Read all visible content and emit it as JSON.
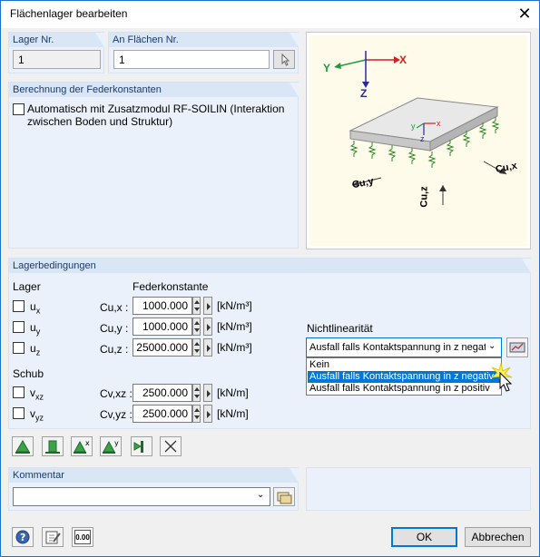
{
  "window": {
    "title": "Flächenlager bearbeiten"
  },
  "lager_nr": {
    "label": "Lager Nr.",
    "value": "1"
  },
  "an_flaechen": {
    "label": "An Flächen Nr.",
    "value": "1"
  },
  "federkonstanten": {
    "label": "Berechnung der Federkonstanten",
    "checkbox_label_line1": "Automatisch mit Zusatzmodul RF-SOILIN (Interaktion",
    "checkbox_label_line2": "zwischen Boden und Struktur)"
  },
  "diagram": {
    "axis_y": "Y",
    "axis_x": "X",
    "axis_z": "Z",
    "small_y": "y",
    "small_x": "x",
    "small_z": "z",
    "cuy": "Cu,y",
    "cux": "Cu,x",
    "cuz": "Cu,z",
    "colors": {
      "y_axis": "#1e9a3b",
      "x_axis": "#d42020",
      "z_axis": "#2a2a9a"
    }
  },
  "lagerbedingungen": {
    "label": "Lagerbedingungen",
    "col_lager": "Lager",
    "col_feder": "Federkonstante",
    "rows": [
      {
        "name": "u",
        "sub": "x",
        "clabel": "Cu,x :",
        "value": "1000.000",
        "unit": "[kN/m³]"
      },
      {
        "name": "u",
        "sub": "y",
        "clabel": "Cu,y :",
        "value": "1000.000",
        "unit": "[kN/m³]"
      },
      {
        "name": "u",
        "sub": "z",
        "clabel": "Cu,z :",
        "value": "25000.000",
        "unit": "[kN/m³]"
      }
    ],
    "schub_label": "Schub",
    "schub_rows": [
      {
        "name": "v",
        "sub": "xz",
        "clabel": "Cv,xz :",
        "value": "2500.000",
        "unit": "[kN/m]"
      },
      {
        "name": "v",
        "sub": "yz",
        "clabel": "Cv,yz :",
        "value": "2500.000",
        "unit": "[kN/m]"
      }
    ],
    "nichtlinearitaet": {
      "label": "Nichtlinearität",
      "selected": "Ausfall falls Kontaktspannung in z negati",
      "options": [
        "Kein",
        "Ausfall falls Kontaktspannung in z negativ",
        "Ausfall falls Kontaktspannung in z positiv"
      ],
      "highlighted_index": 1
    }
  },
  "kommentar": {
    "label": "Kommentar",
    "value": ""
  },
  "buttons": {
    "ok": "OK",
    "cancel": "Abbrechen"
  },
  "bottom_icons": {
    "help": "help-icon",
    "edit": "edit-icon",
    "units": "0.00"
  }
}
